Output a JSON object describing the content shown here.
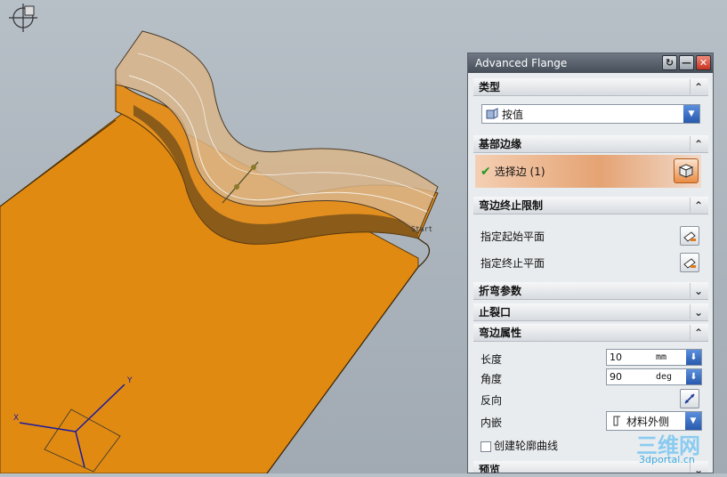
{
  "viewport": {
    "labels": {
      "start_tag": "Start"
    },
    "axis_y": "Y",
    "axis_x": "X",
    "colors": {
      "part_orange": "#e08a12",
      "flange_tan": "#d9b58a",
      "background": "#aeb6be"
    }
  },
  "dialog": {
    "title": "Advanced Flange",
    "buttons": {
      "reset": "↻",
      "minimize": "—",
      "close": "✕"
    },
    "sections": {
      "type": {
        "label": "类型",
        "value": "按值"
      },
      "base_edge": {
        "label": "基部边缘",
        "select_label": "选择边 (1)"
      },
      "flange_limits": {
        "label": "弯边终止限制",
        "start_plane": "指定起始平面",
        "end_plane": "指定终止平面"
      },
      "bend_params": {
        "label": "折弯参数"
      },
      "relief": {
        "label": "止裂口"
      },
      "flange_props": {
        "label": "弯边属性",
        "length_label": "长度",
        "length_value": "10",
        "length_unit": "mm",
        "angle_label": "角度",
        "angle_value": "90",
        "angle_unit": "deg",
        "reverse_label": "反向",
        "inset_label": "内嵌",
        "inset_value": "材料外侧",
        "create_contour_label": "创建轮廓曲线"
      },
      "preview": {
        "label": "预览"
      }
    }
  },
  "watermark": {
    "url": "3dportal.cn"
  }
}
